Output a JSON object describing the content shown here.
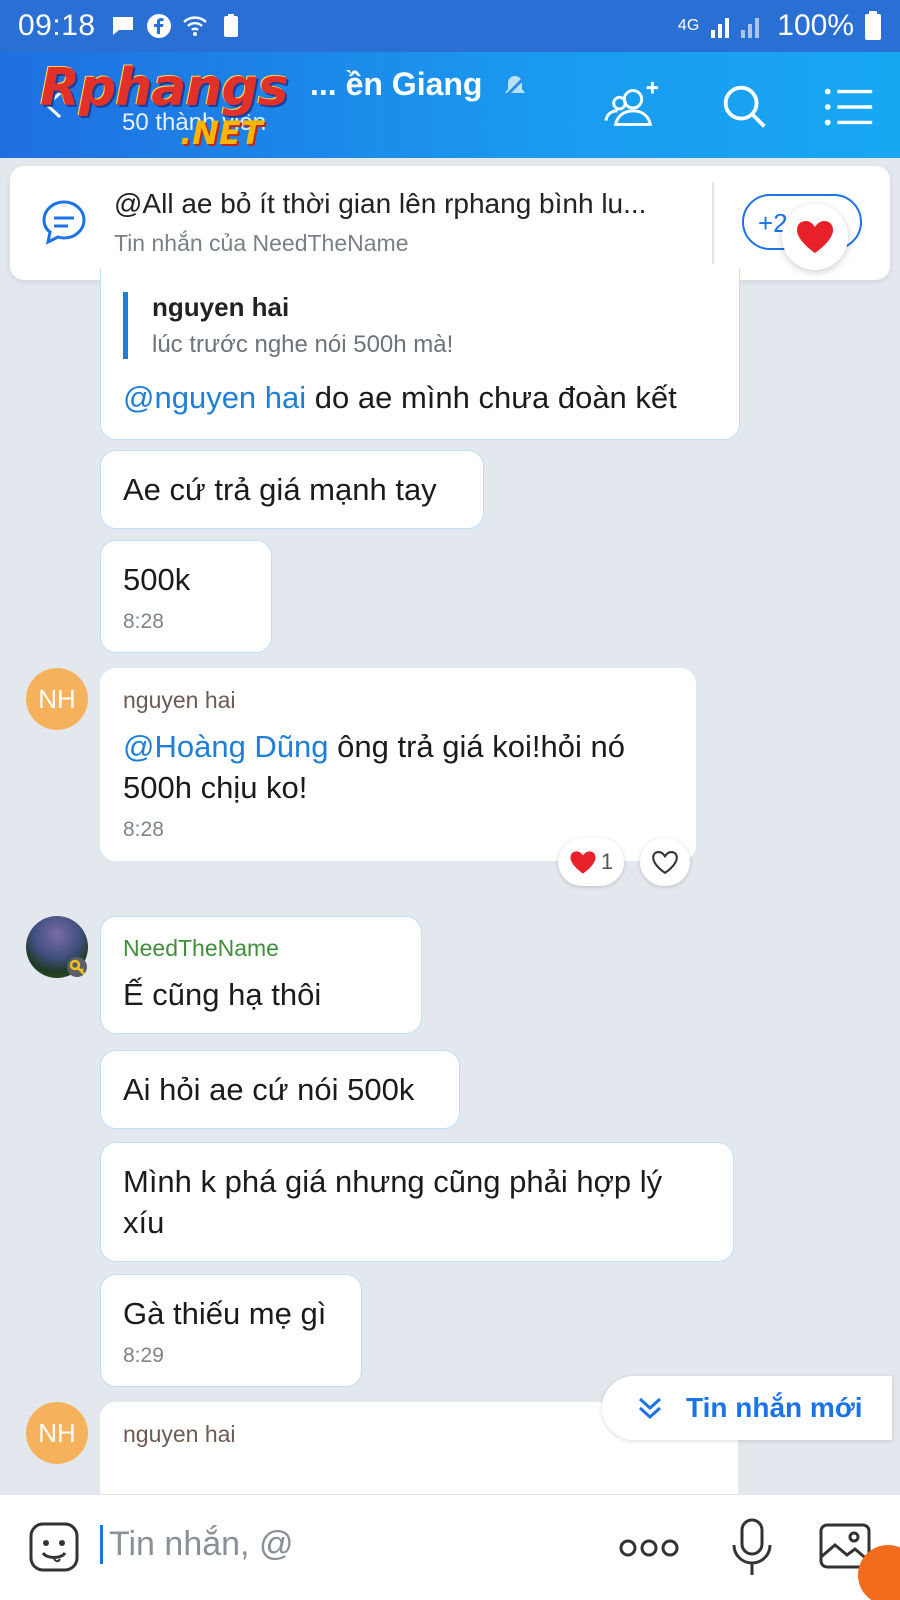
{
  "status_bar": {
    "time": "09:18",
    "battery_percent": "100%",
    "network": "4G"
  },
  "header": {
    "title": "... ền Giang",
    "members": "50 thành viên",
    "watermark_main": "Rphangs",
    "watermark_sub": ".NET"
  },
  "pinned": {
    "message": "@All ae bỏ ít thời gian lên rphang bình lu...",
    "source": "Tin nhắn của NeedTheName",
    "more_count": "+2"
  },
  "messages": [
    {
      "quote_name": "nguyen hai",
      "quote_text": "lúc trước nghe nói 500h mà!",
      "mention": "@nguyen hai",
      "text": " do ae mình chưa đoàn kết"
    },
    {
      "text": "Ae cứ trả giá mạnh tay"
    },
    {
      "text": "500k",
      "time": "8:28"
    },
    {
      "avatar": "NH",
      "sender": "nguyen hai",
      "mention": "@Hoàng Dũng",
      "text": " ông trả giá koi!hỏi nó 500h chịu ko!",
      "time": "8:28",
      "reaction_count": "1"
    },
    {
      "sender": "NeedTheName",
      "text": "Ế cũng hạ thôi"
    },
    {
      "text": "Ai hỏi ae cứ nói 500k"
    },
    {
      "text": "Mình k phá giá nhưng cũng phải hợp lý xíu"
    },
    {
      "text": "Gà thiếu mẹ gì",
      "time": "8:29"
    },
    {
      "avatar": "NH",
      "sender": "nguyen hai"
    }
  ],
  "new_messages_label": "Tin nhắn mới",
  "composer": {
    "placeholder": "Tin nhắn, @"
  },
  "colors": {
    "header": "#1a8fe8",
    "accent": "#1a73e8",
    "mention": "#1f7fd6",
    "nh_avatar": "#f6b15c",
    "need_sender": "#3f8f3a"
  }
}
